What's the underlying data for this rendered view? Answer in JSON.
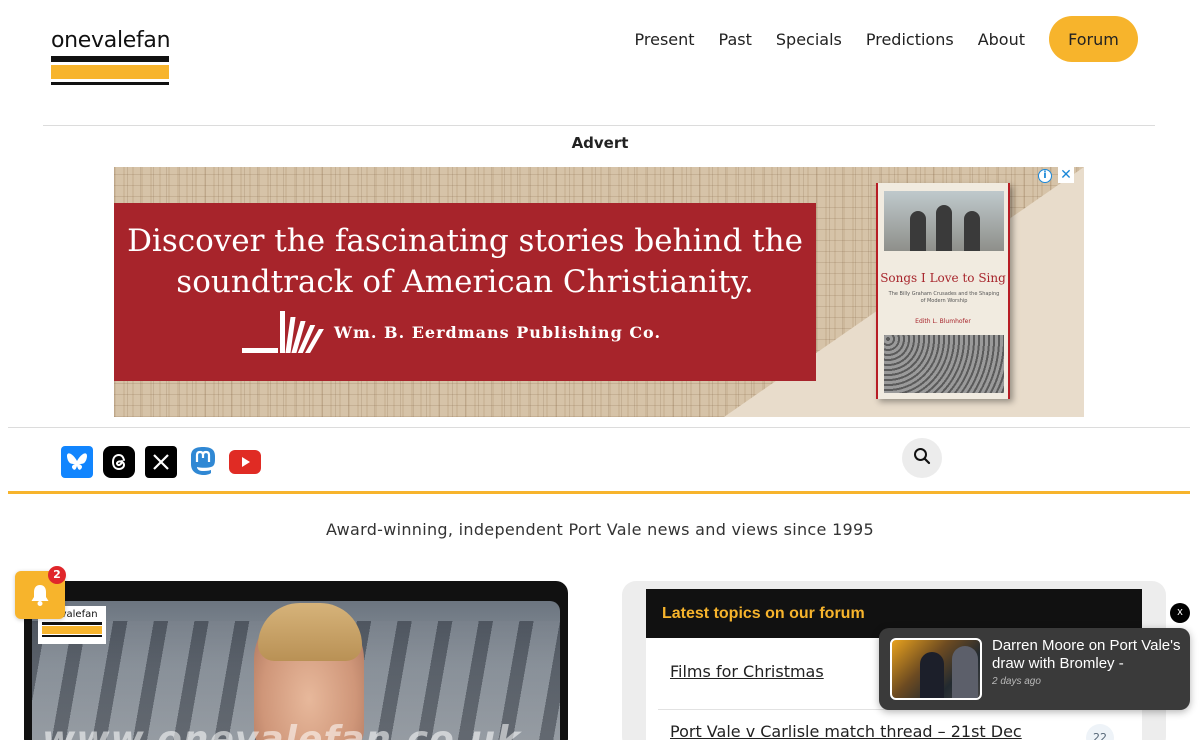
{
  "site": {
    "logo_text": "onevalefan",
    "brand_color": "#f7b42c"
  },
  "nav": {
    "items": [
      "Present",
      "Past",
      "Specials",
      "Predictions",
      "About"
    ],
    "forum_label": "Forum"
  },
  "advert": {
    "label": "Advert",
    "headline_line1": "Discover the fascinating stories behind the",
    "headline_line2": "soundtrack of American Christianity.",
    "publisher": "Wm. B. Eerdmans Publishing Co.",
    "book_title": "Songs I Love to Sing",
    "book_subtitle": "The Billy Graham Crusades and the Shaping of Modern Worship",
    "book_author": "Edith L. Blumhofer",
    "info_icon": "info-icon",
    "close_icon": "close-icon"
  },
  "social": {
    "icons": [
      "bluesky-icon",
      "threads-icon",
      "x-icon",
      "mastodon-icon",
      "youtube-icon"
    ]
  },
  "search": {
    "icon": "search-icon"
  },
  "tagline": "Award-winning, independent Port Vale news and views since 1995",
  "notifications": {
    "count": "2"
  },
  "feature": {
    "watermark": "www.onevalefan.co.uk",
    "logo_text": "onevalefan"
  },
  "forum_widget": {
    "title": "Latest topics on our forum",
    "topics": [
      {
        "title": "Films for Christmas"
      },
      {
        "title": "Port Vale v Carlisle match thread – 21st Dec",
        "count": "22"
      }
    ]
  },
  "toast": {
    "title": "Darren Moore on Port Vale's draw with Bromley -",
    "time": "2 days ago",
    "close_label": "x"
  }
}
